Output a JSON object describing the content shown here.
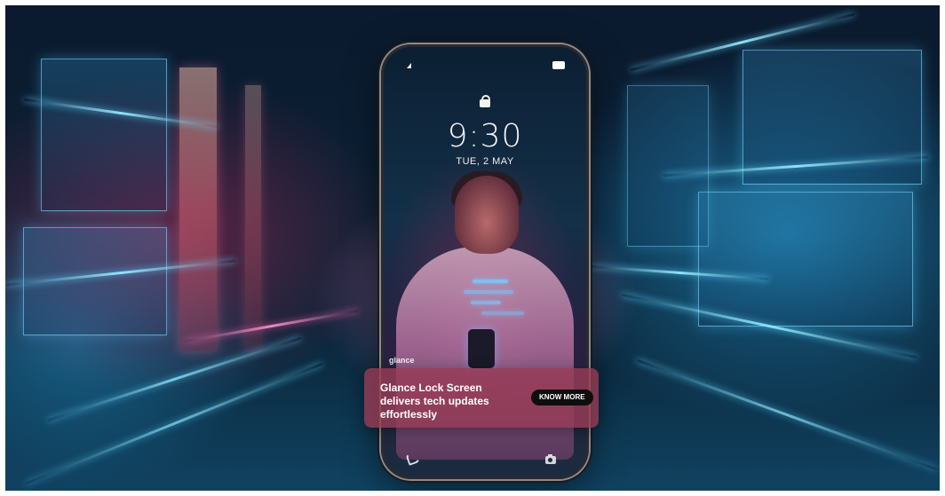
{
  "lockscreen": {
    "time": "9:30",
    "date": "TUE, 2 MAY",
    "brand": "glance"
  },
  "notification": {
    "headline": "Glance Lock Screen delivers tech updates effortlessly",
    "cta_label": "KNOW MORE"
  },
  "icons": {
    "lock": "lock-icon",
    "phone": "phone-icon",
    "camera": "camera-icon",
    "signal": "signal-icon",
    "battery": "battery-icon"
  },
  "colors": {
    "card_background": "#963a56",
    "cta_background": "#0e0e0e",
    "neon_blue": "#5ad2ff",
    "neon_pink": "#ff5aaa"
  }
}
